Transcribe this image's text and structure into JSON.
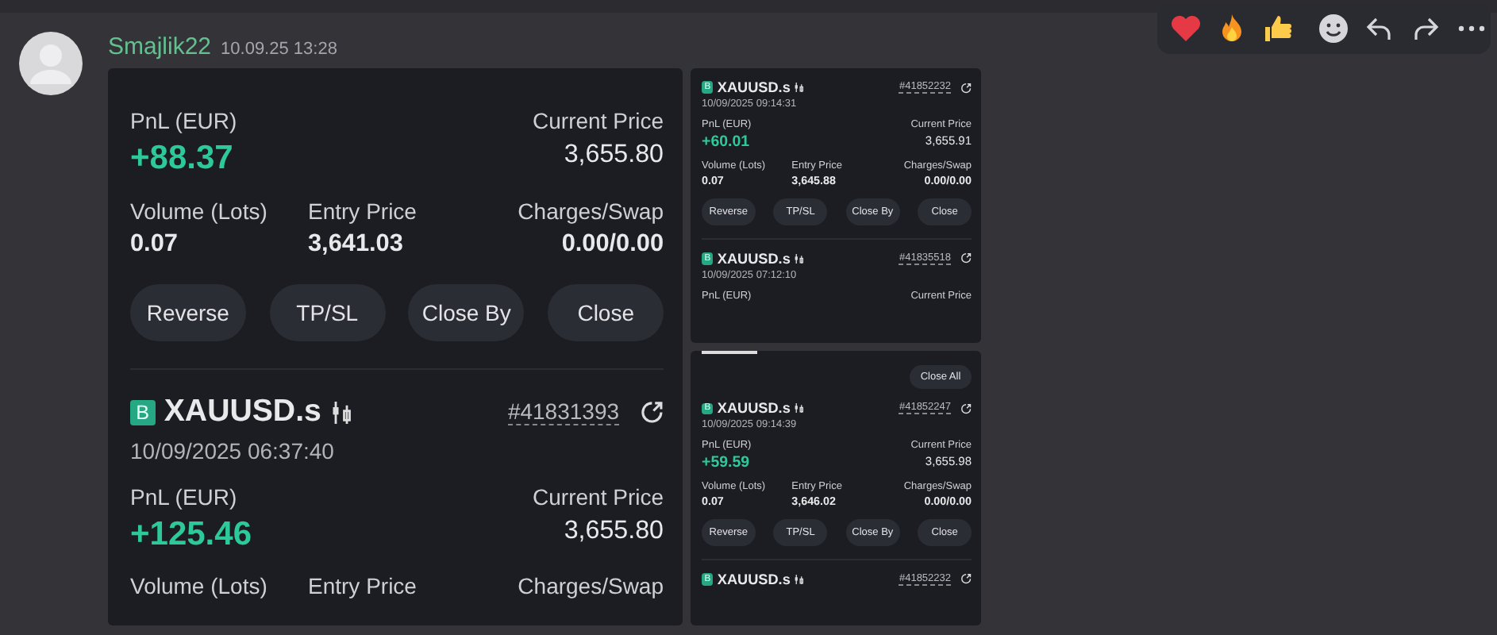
{
  "message": {
    "author": "Smajlik22",
    "time": "10.09.25 13:28"
  },
  "attachments": [
    {
      "kind": "large",
      "entries": [
        {
          "pnl": {
            "label": "PnL (EUR)",
            "value": "+88.37"
          },
          "price": {
            "label": "Current Price",
            "value": "3,655.80"
          },
          "stats": [
            {
              "label": "Volume (Lots)",
              "value": "0.07"
            },
            {
              "label": "Entry Price",
              "value": "3,641.03"
            },
            {
              "label": "Charges/Swap",
              "value": "0.00/0.00"
            }
          ],
          "buttons": [
            "Reverse",
            "TP/SL",
            "Close By",
            "Close"
          ]
        },
        {
          "badge": "B",
          "symbol": "XAUUSD.s",
          "ticket": "#41831393",
          "date": "10/09/2025 06:37:40",
          "pnl": {
            "label": "PnL (EUR)",
            "value": "+125.46"
          },
          "price": {
            "label": "Current Price",
            "value": "3,655.80"
          },
          "stats": [
            {
              "label": "Volume (Lots)"
            },
            {
              "label": "Entry Price"
            },
            {
              "label": "Charges/Swap"
            }
          ]
        }
      ]
    },
    {
      "kind": "small",
      "entries": [
        {
          "badge": "B",
          "symbol": "XAUUSD.s",
          "ticket": "#41852232",
          "date": "10/09/2025 09:14:31",
          "pnl": {
            "label": "PnL (EUR)",
            "value": "+60.01"
          },
          "price": {
            "label": "Current Price",
            "value": "3,655.91"
          },
          "stats": [
            {
              "label": "Volume (Lots)",
              "value": "0.07"
            },
            {
              "label": "Entry Price",
              "value": "3,645.88"
            },
            {
              "label": "Charges/Swap",
              "value": "0.00/0.00"
            }
          ],
          "buttons": [
            "Reverse",
            "TP/SL",
            "Close By",
            "Close"
          ]
        },
        {
          "badge": "B",
          "symbol": "XAUUSD.s",
          "ticket": "#41835518",
          "date": "10/09/2025 07:12:10",
          "pnl": {
            "label": "PnL (EUR)"
          },
          "price": {
            "label": "Current Price"
          }
        }
      ]
    },
    {
      "kind": "small",
      "close_all": "Close All",
      "entries": [
        {
          "badge": "B",
          "symbol": "XAUUSD.s",
          "ticket": "#41852247",
          "date": "10/09/2025 09:14:39",
          "pnl": {
            "label": "PnL (EUR)",
            "value": "+59.59"
          },
          "price": {
            "label": "Current Price",
            "value": "3,655.98"
          },
          "stats": [
            {
              "label": "Volume (Lots)",
              "value": "0.07"
            },
            {
              "label": "Entry Price",
              "value": "3,646.02"
            },
            {
              "label": "Charges/Swap",
              "value": "0.00/0.00"
            }
          ],
          "buttons": [
            "Reverse",
            "TP/SL",
            "Close By",
            "Close"
          ]
        },
        {
          "badge": "B",
          "symbol": "XAUUSD.s",
          "ticket": "#41852232"
        }
      ]
    }
  ]
}
